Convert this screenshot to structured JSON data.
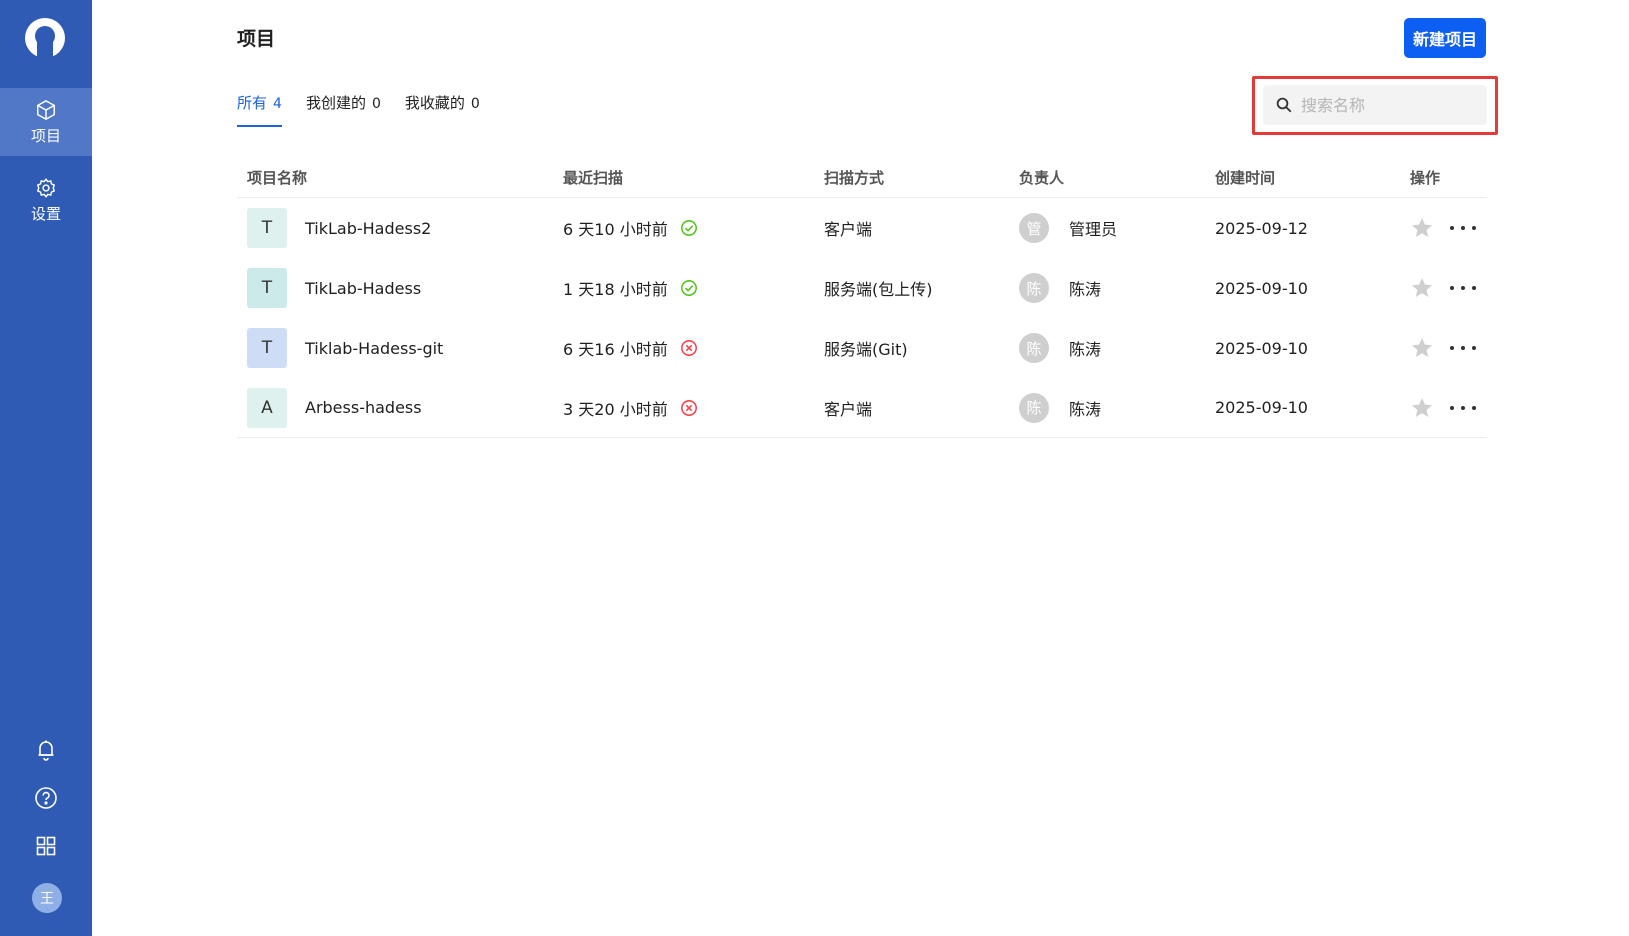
{
  "sidebar": {
    "nav": [
      {
        "label": "项目",
        "icon": "cube-icon",
        "active": true
      },
      {
        "label": "设置",
        "icon": "gear-icon",
        "active": false
      }
    ],
    "bottom_icons": [
      "bell-icon",
      "help-icon",
      "apps-grid-icon"
    ],
    "user_avatar": "王"
  },
  "header": {
    "title": "项目",
    "new_button": "新建项目"
  },
  "tabs": [
    {
      "label": "所有",
      "count": "4",
      "active": true
    },
    {
      "label": "我创建的",
      "count": "0",
      "active": false
    },
    {
      "label": "我收藏的",
      "count": "0",
      "active": false
    }
  ],
  "search": {
    "placeholder": "搜索名称",
    "value": ""
  },
  "table": {
    "columns": [
      "项目名称",
      "最近扫描",
      "扫描方式",
      "负责人",
      "创建时间",
      "操作"
    ],
    "rows": [
      {
        "initial": "T",
        "icon_bg": "#dff1ee",
        "name": "TikLab-Hadess2",
        "last_scan": "6 天10 小时前",
        "status": "success",
        "scan_method": "客户端",
        "owner_initial": "管",
        "owner": "管理员",
        "created": "2025-09-12"
      },
      {
        "initial": "T",
        "icon_bg": "#cdeaea",
        "name": "TikLab-Hadess",
        "last_scan": "1 天18 小时前",
        "status": "success",
        "scan_method": "服务端(包上传)",
        "owner_initial": "陈",
        "owner": "陈涛",
        "created": "2025-09-10"
      },
      {
        "initial": "T",
        "icon_bg": "#cfdcf5",
        "name": "Tiklab-Hadess-git",
        "last_scan": "6 天16 小时前",
        "status": "failed",
        "scan_method": "服务端(Git)",
        "owner_initial": "陈",
        "owner": "陈涛",
        "created": "2025-09-10"
      },
      {
        "initial": "A",
        "icon_bg": "#dff1ee",
        "name": "Arbess-hadess",
        "last_scan": "3 天20 小时前",
        "status": "failed",
        "scan_method": "客户端",
        "owner_initial": "陈",
        "owner": "陈涛",
        "created": "2025-09-10"
      }
    ]
  },
  "colors": {
    "sidebar": "#2f5bb4",
    "accent": "#1e63d9",
    "primary_button": "#0d5ef2",
    "success": "#52c41a",
    "failed": "#f5424b",
    "highlight_border": "#e23b3b"
  }
}
